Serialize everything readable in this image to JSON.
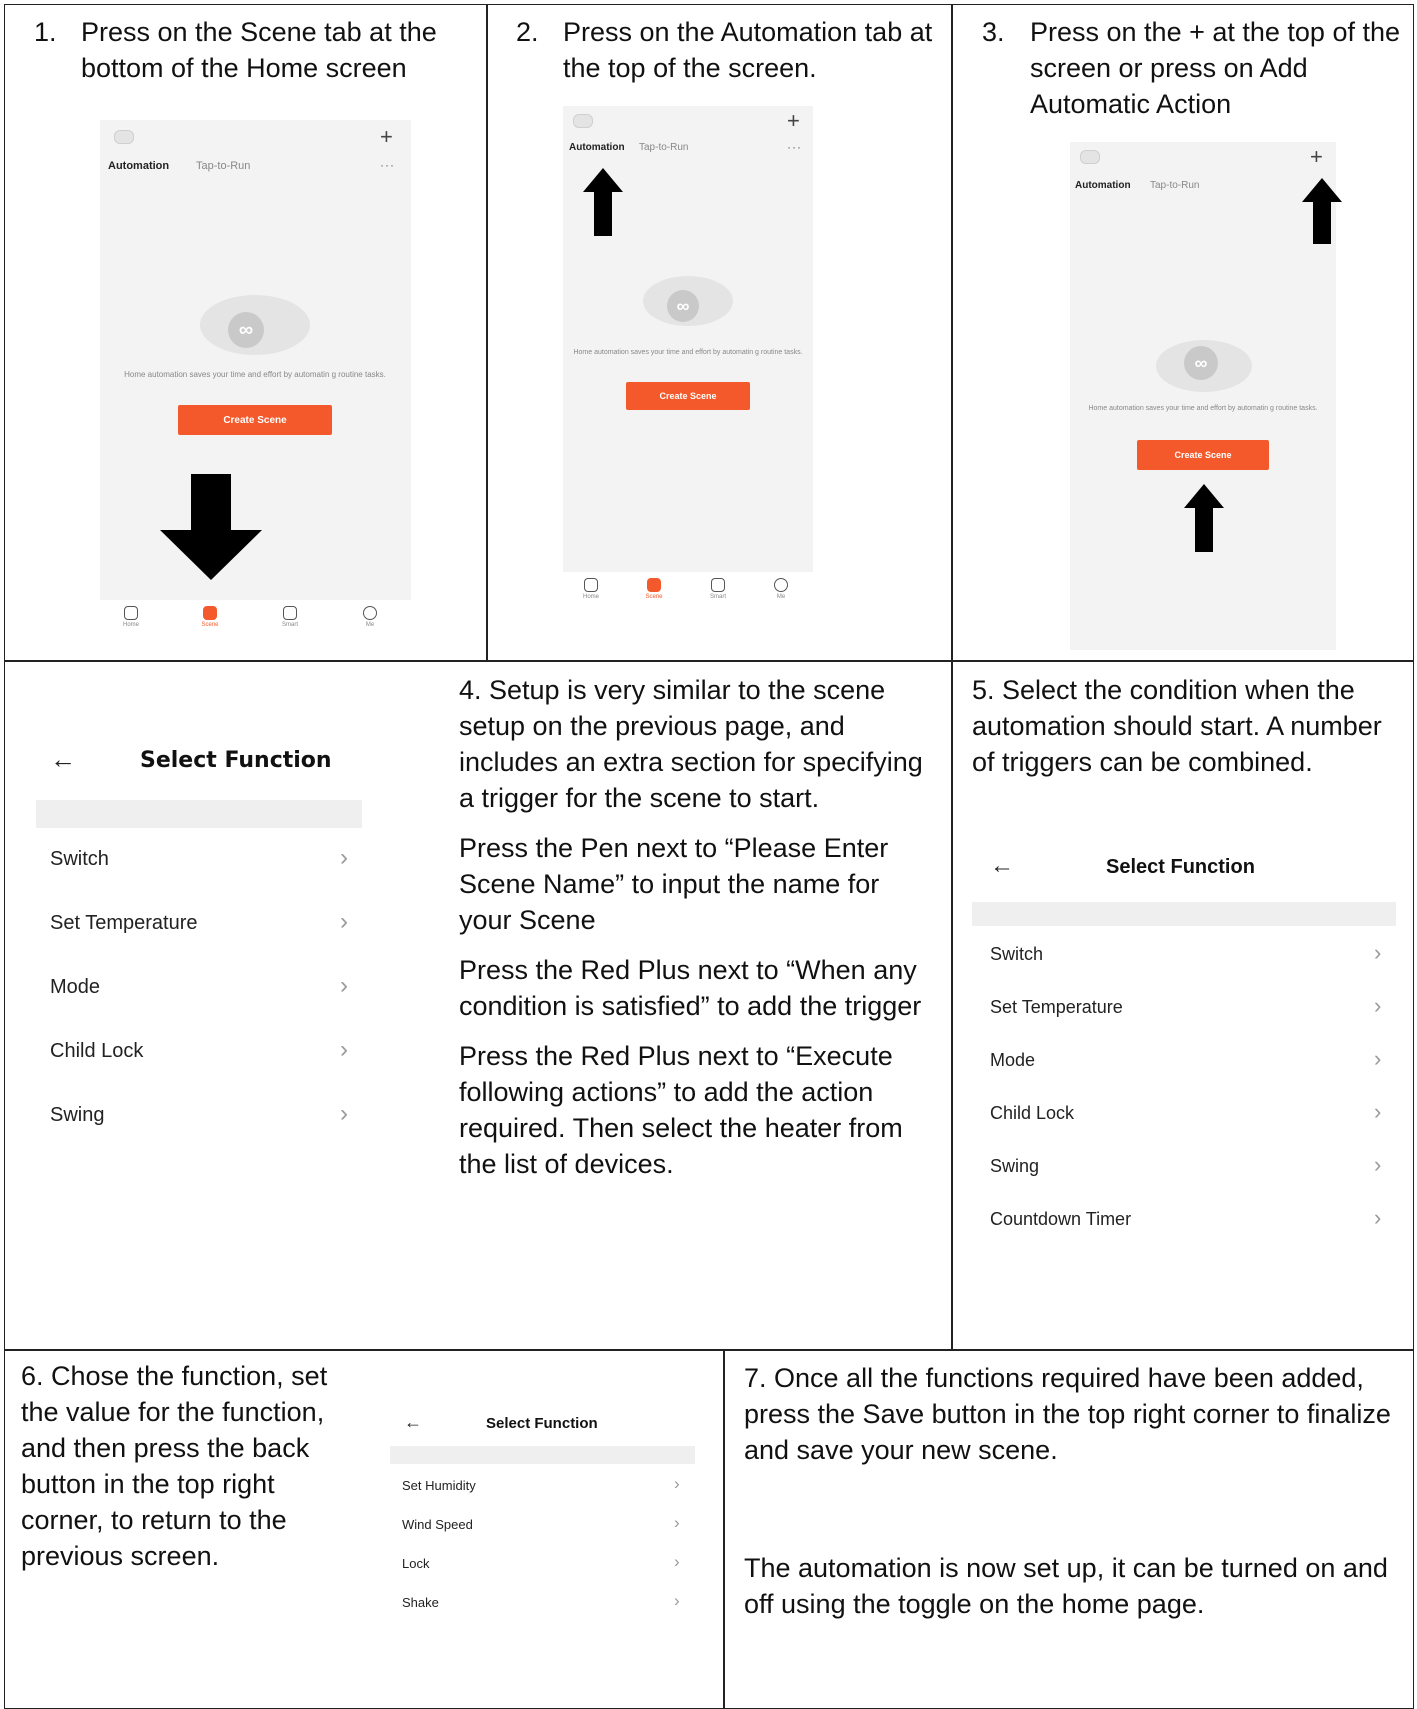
{
  "steps": {
    "s1": {
      "num": "1.",
      "text": "Press on the Scene tab at the bottom of the Home screen"
    },
    "s2": {
      "num": "2.",
      "text": "Press on the Automation tab at the top of the screen."
    },
    "s3": {
      "num": "3.",
      "text": "Press on the + at the top of the screen or press on Add Automatic Action"
    },
    "s4": {
      "p1": "4. Setup is very similar to the scene setup on the previous page, and includes an extra section for specifying a trigger for the scene to start.",
      "p2": "Press the Pen next to “Please Enter Scene Name” to input the name for your Scene",
      "p3": "Press the Red Plus next to “When any condition is satisfied” to add the trigger",
      "p4": "Press the Red Plus next to “Execute following actions” to add the action required.  Then select the heater from the list of devices."
    },
    "s5": {
      "text": "5. Select the condition when the automation should start.  A number of triggers can be combined."
    },
    "s6": {
      "text": "6. Chose the function, set the value for the function, and then press the back button in the top right corner, to return to the previous screen."
    },
    "s7": {
      "p1": "7. Once all the functions required have been added, press the Save button in the top right corner to finalize and save your new scene.",
      "p2": "The automation is now set up, it can be turned on and off using the toggle on the home page."
    }
  },
  "phone": {
    "tab_automation": "Automation",
    "tab_tap_to_run": "Tap-to-Run",
    "plus": "+",
    "dots": "···",
    "message": "Home automation saves your time and effort by automatin g routine tasks.",
    "create_button": "Create Scene",
    "nav": [
      "Home",
      "Scene",
      "Smart",
      "Me"
    ],
    "logo_glyph": "∞"
  },
  "select_function": {
    "back": "←",
    "title": "Select Function",
    "chevron": "›",
    "list_a": [
      "Switch",
      "Set Temperature",
      "Mode",
      "Child Lock",
      "Swing"
    ],
    "list_b": [
      "Switch",
      "Set Temperature",
      "Mode",
      "Child Lock",
      "Swing",
      "Countdown Timer"
    ],
    "list_c": [
      "Set Humidity",
      "Wind Speed",
      "Lock",
      "Shake"
    ]
  },
  "colors": {
    "accent": "#f4592c",
    "border": "#222222"
  }
}
